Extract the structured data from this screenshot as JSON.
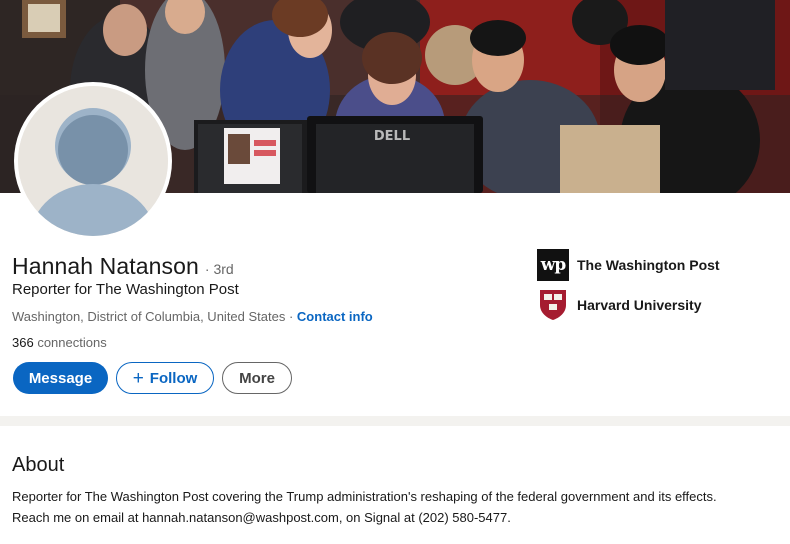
{
  "profile": {
    "name": "Hannah Natanson",
    "degree": "· 3rd",
    "headline": "Reporter for The Washington Post",
    "location": "Washington, District of Columbia, United States · ",
    "contact_label": "Contact info",
    "connections_count": "366",
    "connections_label": " connections"
  },
  "actions": {
    "message": "Message",
    "follow_plus": "+",
    "follow": "Follow",
    "more": "More"
  },
  "orgs": [
    {
      "name": "The Washington Post",
      "logo_text": "wp",
      "icon": "washington-post-logo"
    },
    {
      "name": "Harvard University",
      "icon": "harvard-shield-logo"
    }
  ],
  "banner": {
    "monitor_brand": "DELL"
  },
  "about": {
    "title": "About",
    "text": "Reporter for The Washington Post covering the Trump administration's reshaping of the federal government and its effects. Reach me on email at hannah.natanson@washpost.com, on Signal at (202) 580-5477."
  },
  "colors": {
    "link": "#0a66c2",
    "harvard_crimson": "#a51c30"
  }
}
